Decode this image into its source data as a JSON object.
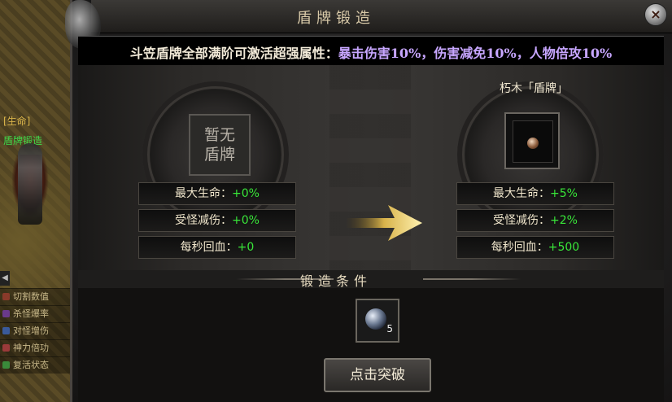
{
  "window": {
    "title": "盾牌锻造",
    "close_label": "×"
  },
  "banner": {
    "prefix": "斗笠盾牌全部满阶可激活超强属性：",
    "bonus": "暴击伤害10%，伤害减免10%，人物倍攻10%"
  },
  "left_slot": {
    "line1": "暂无",
    "line2": "盾牌",
    "stats": [
      {
        "key": "最大生命：",
        "value": "+0%"
      },
      {
        "key": "受怪减伤：",
        "value": "+0%"
      },
      {
        "key": "每秒回血：",
        "value": "+0"
      }
    ]
  },
  "right_slot": {
    "label": "朽木「盾牌」",
    "icon": "shield-item-icon",
    "stats": [
      {
        "key": "最大生命：",
        "value": "+5%"
      },
      {
        "key": "受怪减伤：",
        "value": "+2%"
      },
      {
        "key": "每秒回血：",
        "value": "+500"
      }
    ]
  },
  "requirements": {
    "title": "锻造条件",
    "item_icon": "material-orb-icon",
    "count": "5"
  },
  "action": {
    "label": "点击突破"
  },
  "sidebar": {
    "life_tag": "[生命]",
    "forge_tag": "盾牌锻造",
    "arrow": "◀",
    "items": [
      "切割数值",
      "杀怪爆率",
      "对怪增伤",
      "神力倍功",
      "复活状态"
    ]
  },
  "colors": {
    "stat_value": "#39e639",
    "bonus_text": "#c7a6ff",
    "tag_gold": "#d9b44a",
    "tag_green": "#3fd94a"
  }
}
